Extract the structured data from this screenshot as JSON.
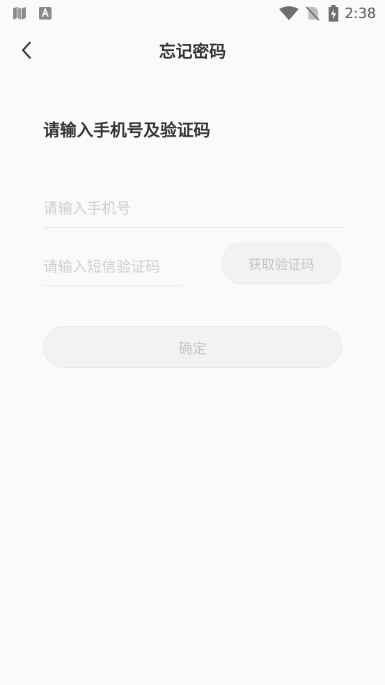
{
  "status_bar": {
    "time": "2:38",
    "left_icons": [
      "map-icon",
      "font-a-icon"
    ],
    "right_icons": [
      "wifi-icon",
      "no-sim-icon",
      "battery-charging-icon"
    ]
  },
  "header": {
    "title": "忘记密码",
    "back_icon": "chevron-left-icon"
  },
  "form": {
    "heading": "请输入手机号及验证码",
    "phone": {
      "value": "",
      "placeholder": "请输入手机号"
    },
    "sms_code": {
      "value": "",
      "placeholder": "请输入短信验证码"
    },
    "get_code_label": "获取验证码",
    "confirm_label": "确定"
  },
  "colors": {
    "background": "#fafaf8",
    "title_text": "#333333",
    "placeholder": "#cfcfcd",
    "button_bg": "#f2f2f1",
    "button_text": "#c6c6c4",
    "divider": "#e8e8e6"
  }
}
